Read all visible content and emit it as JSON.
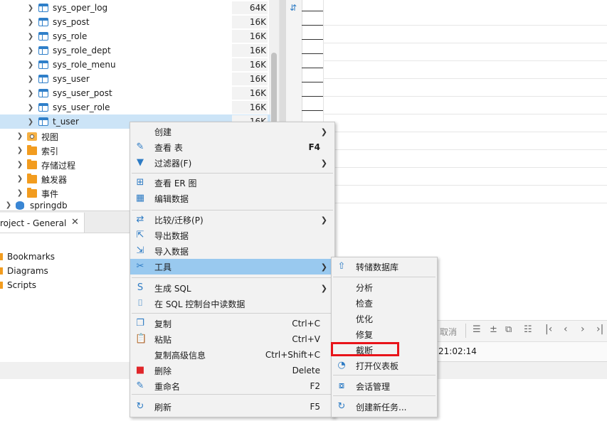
{
  "tree": {
    "tables": [
      {
        "name": "sys_oper_log",
        "size": "64K"
      },
      {
        "name": "sys_post",
        "size": "16K"
      },
      {
        "name": "sys_role",
        "size": "16K"
      },
      {
        "name": "sys_role_dept",
        "size": "16K"
      },
      {
        "name": "sys_role_menu",
        "size": "16K"
      },
      {
        "name": "sys_user",
        "size": "16K"
      },
      {
        "name": "sys_user_post",
        "size": "16K"
      },
      {
        "name": "sys_user_role",
        "size": "16K"
      },
      {
        "name": "t_user",
        "size": "16K"
      }
    ],
    "folders": [
      "视图",
      "索引",
      "存储过程",
      "触发器",
      "事件"
    ],
    "next_db": "springdb"
  },
  "project_panel": {
    "tab_title": "roject - General",
    "items": [
      "Bookmarks",
      "Diagrams",
      "Scripts"
    ]
  },
  "editor": {
    "cancel_label": "取消",
    "time_text": "21:02:14"
  },
  "context_menu": {
    "items": [
      {
        "label": "创建",
        "shortcut": "",
        "submenu": true,
        "icon": "none"
      },
      {
        "label": "查看 表",
        "shortcut": "F4",
        "submenu": false,
        "icon": "pencil-icon"
      },
      {
        "label": "过滤器(F)",
        "shortcut": "",
        "submenu": true,
        "icon": "filter-icon"
      },
      {
        "label": "查看 ER 图",
        "shortcut": "",
        "submenu": false,
        "icon": "er-diagram-icon"
      },
      {
        "label": "编辑数据",
        "shortcut": "",
        "submenu": false,
        "icon": "edit-data-icon"
      },
      {
        "label": "比较/迁移(P)",
        "shortcut": "",
        "submenu": true,
        "icon": "compare-icon"
      },
      {
        "label": "导出数据",
        "shortcut": "",
        "submenu": false,
        "icon": "export-icon"
      },
      {
        "label": "导入数据",
        "shortcut": "",
        "submenu": false,
        "icon": "import-icon"
      },
      {
        "label": "工具",
        "shortcut": "",
        "submenu": true,
        "icon": "tools-icon"
      },
      {
        "label": "生成 SQL",
        "shortcut": "",
        "submenu": true,
        "icon": "sql-icon"
      },
      {
        "label": "在 SQL 控制台中读数据",
        "shortcut": "",
        "submenu": false,
        "icon": "console-icon"
      },
      {
        "label": "复制",
        "shortcut": "Ctrl+C",
        "submenu": false,
        "icon": "copy-icon"
      },
      {
        "label": "粘贴",
        "shortcut": "Ctrl+V",
        "submenu": false,
        "icon": "paste-icon"
      },
      {
        "label": "复制高级信息",
        "shortcut": "Ctrl+Shift+C",
        "submenu": false,
        "icon": "none"
      },
      {
        "label": "删除",
        "shortcut": "Delete",
        "submenu": false,
        "icon": "delete-icon"
      },
      {
        "label": "重命名",
        "shortcut": "F2",
        "submenu": false,
        "icon": "rename-icon"
      },
      {
        "label": "刷新",
        "shortcut": "F5",
        "submenu": false,
        "icon": "refresh-icon"
      }
    ]
  },
  "tools_submenu": {
    "items": [
      {
        "label": "转储数据库",
        "icon": "upload-icon"
      },
      {
        "label": "分析",
        "icon": "none"
      },
      {
        "label": "检查",
        "icon": "none"
      },
      {
        "label": "优化",
        "icon": "none"
      },
      {
        "label": "修复",
        "icon": "none"
      },
      {
        "label": "截断",
        "icon": "none"
      },
      {
        "label": "打开仪表板",
        "icon": "dashboard-icon"
      },
      {
        "label": "会话管理",
        "icon": "session-icon"
      },
      {
        "label": "创建新任务...",
        "icon": "task-icon"
      }
    ]
  },
  "colors": {
    "highlight": "#99c9ef",
    "selection": "#cce4f7",
    "annotation": "#e8141a",
    "accent": "#2d7bc4"
  }
}
